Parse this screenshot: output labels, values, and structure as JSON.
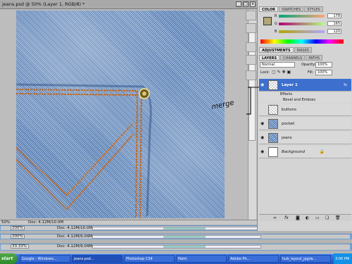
{
  "document": {
    "title": "jeans.psd @ 50% (Layer 1, RGB/8) *",
    "zoom": "50%",
    "doc_info": "Doc: 4.12M/10.0M",
    "win_buttons": [
      "_",
      "□",
      "x"
    ]
  },
  "other_windows": [
    {
      "zoom": "200%",
      "doc": "Doc: 4.12M/10.0M"
    },
    {
      "zoom": "200%",
      "doc": "Doc: 4.12M/9.04M"
    },
    {
      "zoom": "33.33%",
      "doc": "Doc: 4.12M/9.04M"
    }
  ],
  "color_panel": {
    "tabs": [
      "COLOR",
      "SWATCHES",
      "STYLES"
    ],
    "r_label": "R",
    "g_label": "G",
    "b_label": "B",
    "r": "178",
    "g": "165",
    "b": "120",
    "foreground": "#b2a578",
    "background": "#ffffff"
  },
  "adjust_tabs": [
    "ADJUSTMENTS",
    "MASKS"
  ],
  "layers_panel": {
    "tabs": [
      "LAYERS",
      "CHANNELS",
      "PATHS"
    ],
    "blend_mode": "Normal",
    "opacity_label": "Opacity:",
    "opacity": "100%",
    "lock_label": "Lock:",
    "fill_label": "Fill:",
    "fill": "100%",
    "fx": "fx",
    "effects_label": "Effects",
    "effect_item": "Bevel and Emboss",
    "layers": [
      {
        "name": "Layer 1",
        "selected": true
      },
      {
        "name": "buttons",
        "selected": false
      },
      {
        "name": "pocket",
        "selected": false
      },
      {
        "name": "jeans",
        "selected": false
      },
      {
        "name": "Background",
        "selected": false
      }
    ],
    "bottom_icons": [
      "link-icon",
      "fx-icon",
      "mask-icon",
      "adjustment-icon",
      "folder-icon",
      "new-layer-icon",
      "trash-icon"
    ]
  },
  "annotation": {
    "text": "merge"
  },
  "taskbar": {
    "start": "start",
    "items": [
      "Google - Windows...",
      "jeans.psd...",
      "Photoshop CS4",
      "Paint",
      "Adobe Ph...",
      "hub_layout_jpg/w..."
    ],
    "clock": "3:00 PM"
  }
}
